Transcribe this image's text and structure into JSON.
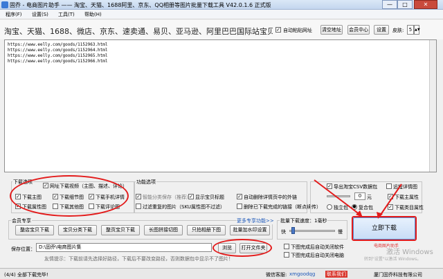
{
  "window": {
    "title": "固乔 - 电商图片助手 —— 淘宝、天猫、1688阿里、京东、QQ相册等图片批量下载工具 V42.0.1.6 正式版",
    "minimize": "—",
    "maximize": "□",
    "close": "✕"
  },
  "menu": [
    {
      "label": "程序(F)"
    },
    {
      "label": "设置(S)"
    },
    {
      "label": "工具(T)"
    },
    {
      "label": "帮助(H)"
    }
  ],
  "search": {
    "label": "淘宝、天猫、1688、微店、京东、速卖通、易贝、亚马逊、阿里巴巴国际站宝贝地址:",
    "auto_paste_label": "自动粘贴网址",
    "auto_paste_checked": true,
    "clear_button": "清空地址",
    "member_center_button": "会员中心",
    "settings_button": "设置",
    "skin_label": "皮肤:",
    "skin_value": "5"
  },
  "url_lines": [
    "https://www.eelly.com/goods/1152963.html",
    "https://www.eelly.com/goods/1152964.html",
    "https://www.eelly.com/goods/1152965.html",
    "https://www.eelly.com/goods/1152966.html"
  ],
  "download_options": {
    "title": "下载选项",
    "items": [
      {
        "label": "网址下载视频（主图、描述、评论）",
        "checked": true
      },
      {
        "label": "下载主图",
        "checked": true
      },
      {
        "label": "下载细节图",
        "checked": true
      },
      {
        "label": "下载手机详情",
        "checked": true
      },
      {
        "label": "下载属性图",
        "checked": true
      },
      {
        "label": "下载其他图",
        "checked": false
      },
      {
        "label": "下载评论图",
        "checked": false
      }
    ]
  },
  "function_options": {
    "title": "功能选项",
    "items": [
      {
        "label": "智能分类保存（推荐）",
        "checked": true
      },
      {
        "label": "显示宝贝标题",
        "checked": true
      },
      {
        "label": "自动删除详情页中的外链",
        "checked": true
      },
      {
        "label": "过滤重复的图片（SKU属性图不过滤）",
        "checked": false
      },
      {
        "label": "删除已下载完成的链接（断点续传）",
        "checked": false
      }
    ],
    "more_link": "更多专享功能>>"
  },
  "right_options": {
    "csv_label": "导出淘宝CSV数据包",
    "csv_checked": true,
    "detail_label": "远程详情图",
    "detail_checked": false,
    "interval_value": "0",
    "interval_unit": "元",
    "split_label": "独立包",
    "merge_label": "复合包",
    "merge_selected": true,
    "main_attr_label": "下载主属性",
    "main_attr_checked": true,
    "category_attr_label": "下载类目属性",
    "category_attr_checked": true
  },
  "member": {
    "title": "会员专享",
    "buttons": [
      "整店宝贝下载",
      "宝贝分类下载",
      "整页宝贝下载",
      "长图拼接切图",
      "只拍相册下图",
      "批量加水印设置"
    ]
  },
  "speed": {
    "label": "批量下载速度：1毫秒",
    "fast": "快",
    "slow": "慢",
    "level": 0.05
  },
  "start_button": "立即下载",
  "save": {
    "label": "保存位置：",
    "path": "D:\\固乔\\电商图片集",
    "browse_button": "浏览",
    "open_folder_button": "打开文件夹",
    "tip": "友情提示：下载前请先选择好路径，下载后不要改变路径，否则数据包中显示不了图片！"
  },
  "after_options": [
    {
      "label": "下图完成后自动关闭软件",
      "checked": false
    },
    {
      "label": "下图完成后自动关闭电脑",
      "checked": false
    }
  ],
  "status": {
    "progress": "(4/4) 全部下载完毕!",
    "wechat_label": "微信客服:",
    "wechat_value": "xmgoodqg",
    "contact": "联系我们",
    "company": "厦门固乔科技有限公司"
  },
  "watermark": {
    "line1": "激活 Windows",
    "line2": "转到\"设置\"以激活 Windows。",
    "brand": "电商图片助手"
  },
  "colors": {
    "annotation": "#e31b1b",
    "link_blue": "#1a56b8"
  }
}
